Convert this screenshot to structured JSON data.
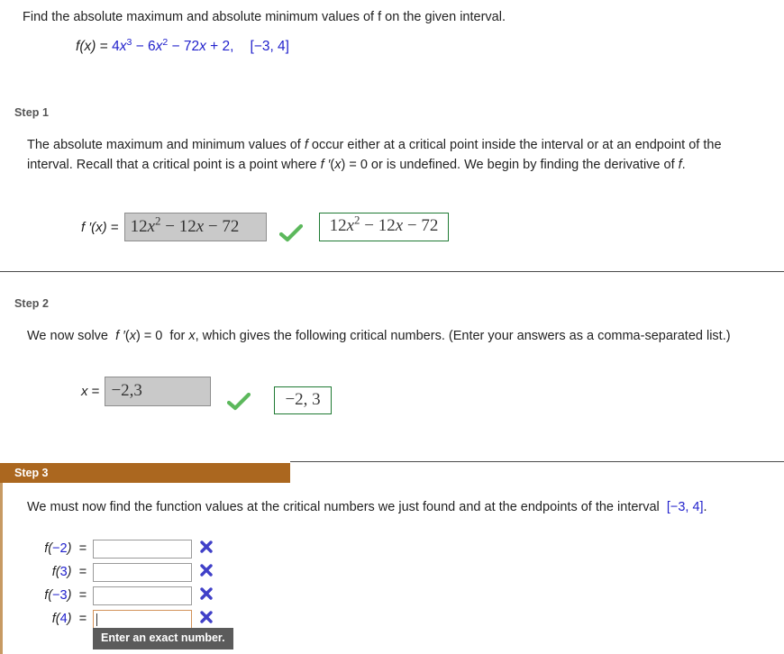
{
  "problem": {
    "prompt": "Find the absolute maximum and absolute minimum values of f on the given interval.",
    "function_label": "f(x)",
    "equals": "=",
    "expression": "4x3 − 6x2 − 72x + 2,",
    "interval": "[−3, 4]"
  },
  "step1": {
    "label": "Step 1",
    "body": "The absolute maximum and minimum values of f occur either at a critical point inside the interval or at an endpoint of the interval. Recall that a critical point is a point where f ′(x) = 0 or is undefined. We begin by finding the derivative of f.",
    "answer_prefix": "f ′(x) =",
    "answer_value": "12x2 − 12x − 72",
    "status_icon": "check-icon",
    "correct_answer": "12x2 − 12x − 72"
  },
  "step2": {
    "label": "Step 2",
    "body": "We now solve  f ′(x) = 0  for x, which gives the following critical numbers. (Enter your answers as a comma-separated list.)",
    "answer_prefix": "x =",
    "answer_value": "−2,3",
    "status_icon": "check-icon",
    "correct_answer": "−2, 3"
  },
  "step3": {
    "label": "Step 3",
    "header_color": "#ab671f",
    "body": "We must now find the function values at the critical numbers we just found and at the endpoints of the interval  [−3, 4].",
    "rows": [
      {
        "label": "f(−2)",
        "equals": "=",
        "value": "",
        "status_icon": "x-icon",
        "focused": false
      },
      {
        "label": "f(3)",
        "equals": "=",
        "value": "",
        "status_icon": "x-icon",
        "focused": false
      },
      {
        "label": "f(−3)",
        "equals": "=",
        "value": "",
        "status_icon": "x-icon",
        "focused": false
      },
      {
        "label": "f(4)",
        "equals": "=",
        "value": "",
        "status_icon": "x-icon",
        "focused": true
      }
    ],
    "tooltip": "Enter an exact number."
  },
  "colors": {
    "math_blue": "#2222cc",
    "correct_green": "#5cb85c",
    "correct_border_green": "#1f7a33",
    "incorrect_blue": "#4040c8",
    "step_accent": "#ab671f",
    "tooltip_bg": "#5b5b5b"
  }
}
